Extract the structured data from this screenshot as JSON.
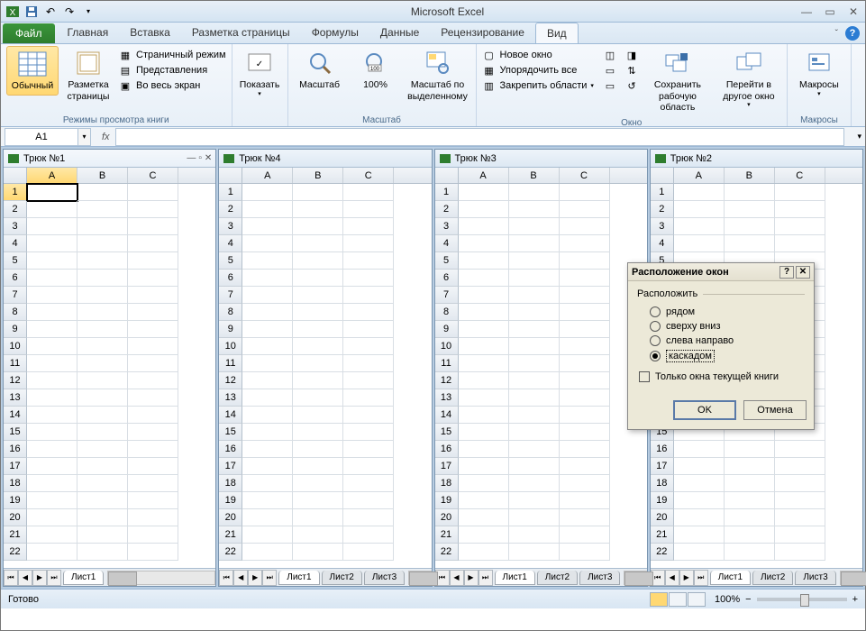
{
  "app": {
    "title": "Microsoft Excel"
  },
  "tabs": {
    "file": "Файл",
    "items": [
      "Главная",
      "Вставка",
      "Разметка страницы",
      "Формулы",
      "Данные",
      "Рецензирование",
      "Вид"
    ],
    "active": "Вид"
  },
  "ribbon": {
    "group_views": {
      "label": "Режимы просмотра книги",
      "normal": "Обычный",
      "page_layout": "Разметка\nстраницы",
      "page_break": "Страничный режим",
      "custom_views": "Представления",
      "full_screen": "Во весь экран"
    },
    "group_show": {
      "label": "",
      "show_btn": "Показать"
    },
    "group_zoom": {
      "label": "Масштаб",
      "zoom": "Масштаб",
      "hundred": "100%",
      "to_selection": "Масштаб по\nвыделенному"
    },
    "group_window": {
      "label": "Окно",
      "new_window": "Новое окно",
      "arrange_all": "Упорядочить все",
      "freeze": "Закрепить области",
      "save_workspace": "Сохранить\nрабочую область",
      "switch": "Перейти в\nдругое окно"
    },
    "group_macros": {
      "label": "Макросы",
      "macros": "Макросы"
    }
  },
  "namebox": "A1",
  "workbooks": [
    {
      "title": "Трюк №1",
      "active": true,
      "sheets": [
        "Лист1"
      ]
    },
    {
      "title": "Трюк №4",
      "active": false,
      "sheets": [
        "Лист1",
        "Лист2",
        "Лист3"
      ]
    },
    {
      "title": "Трюк №3",
      "active": false,
      "sheets": [
        "Лист1",
        "Лист2",
        "Лист3"
      ]
    },
    {
      "title": "Трюк №2",
      "active": false,
      "sheets": [
        "Лист1",
        "Лист2",
        "Лист3"
      ]
    }
  ],
  "columns": [
    "A",
    "B",
    "C"
  ],
  "rows": 22,
  "dialog": {
    "title": "Расположение окон",
    "group": "Расположить",
    "options": [
      "рядом",
      "сверху вниз",
      "слева направо",
      "каскадом"
    ],
    "selected": "каскадом",
    "checkbox": "Только окна текущей книги",
    "ok": "OK",
    "cancel": "Отмена"
  },
  "status": {
    "ready": "Готово",
    "zoom": "100%"
  }
}
